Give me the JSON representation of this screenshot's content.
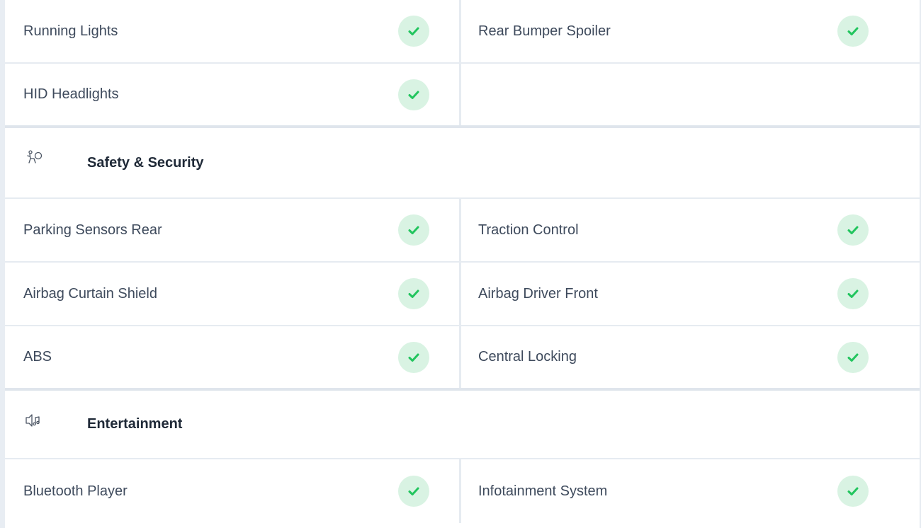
{
  "groups": [
    {
      "rows": [
        {
          "left": "Running Lights",
          "right": "Rear Bumper Spoiler"
        },
        {
          "left": "HID Headlights",
          "right": ""
        }
      ]
    },
    {
      "title": "Safety & Security",
      "icon": "airbag-icon",
      "rows": [
        {
          "left": "Parking Sensors Rear",
          "right": "Traction Control"
        },
        {
          "left": "Airbag Curtain Shield",
          "right": "Airbag Driver Front"
        },
        {
          "left": "ABS",
          "right": "Central Locking"
        }
      ]
    },
    {
      "title": "Entertainment",
      "icon": "speaker-music-icon",
      "rows": [
        {
          "left": "Bluetooth Player",
          "right": "Infotainment System"
        }
      ]
    }
  ],
  "colors": {
    "check_bg": "#d9f3e3",
    "check_stroke": "#22c55e",
    "divider": "#e6ebf1",
    "text": "#3e4a5c"
  },
  "check_icon": "check-icon"
}
